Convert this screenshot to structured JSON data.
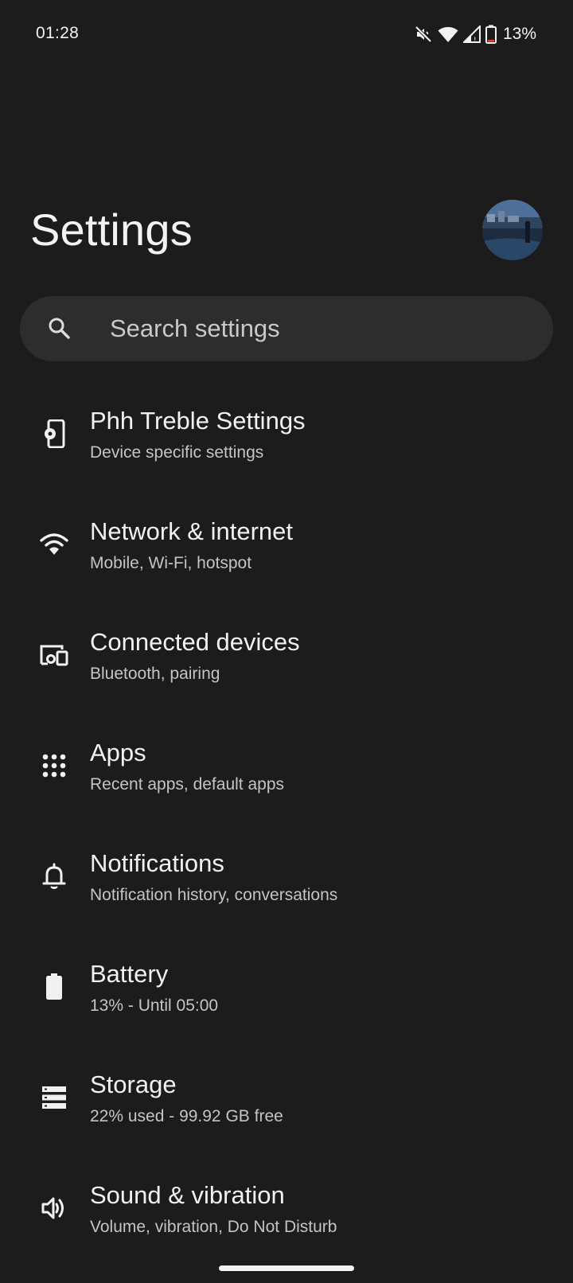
{
  "status_bar": {
    "time": "01:28",
    "battery_percent": "13%",
    "icons": [
      "mute-icon",
      "wifi-icon",
      "cell-signal-icon",
      "battery-icon"
    ]
  },
  "header": {
    "title": "Settings"
  },
  "search": {
    "placeholder": "Search settings"
  },
  "settings": {
    "items": [
      {
        "icon": "device-settings-icon",
        "title": "Phh Treble Settings",
        "summary": "Device specific settings"
      },
      {
        "icon": "wifi-icon",
        "title": "Network & internet",
        "summary": "Mobile, Wi-Fi, hotspot"
      },
      {
        "icon": "devices-icon",
        "title": "Connected devices",
        "summary": "Bluetooth, pairing"
      },
      {
        "icon": "apps-grid-icon",
        "title": "Apps",
        "summary": "Recent apps, default apps"
      },
      {
        "icon": "bell-icon",
        "title": "Notifications",
        "summary": "Notification history, conversations"
      },
      {
        "icon": "battery-icon",
        "title": "Battery",
        "summary": "13% - Until 05:00"
      },
      {
        "icon": "storage-icon",
        "title": "Storage",
        "summary": "22% used - 99.92 GB free"
      },
      {
        "icon": "speaker-icon",
        "title": "Sound & vibration",
        "summary": "Volume, vibration, Do Not Disturb"
      }
    ]
  },
  "colors": {
    "background": "#1c1c1c",
    "search_bg": "#2d2d2d",
    "text_primary": "#f1f1f1",
    "text_secondary": "#c4c4c4",
    "battery_low": "#ea4335"
  }
}
